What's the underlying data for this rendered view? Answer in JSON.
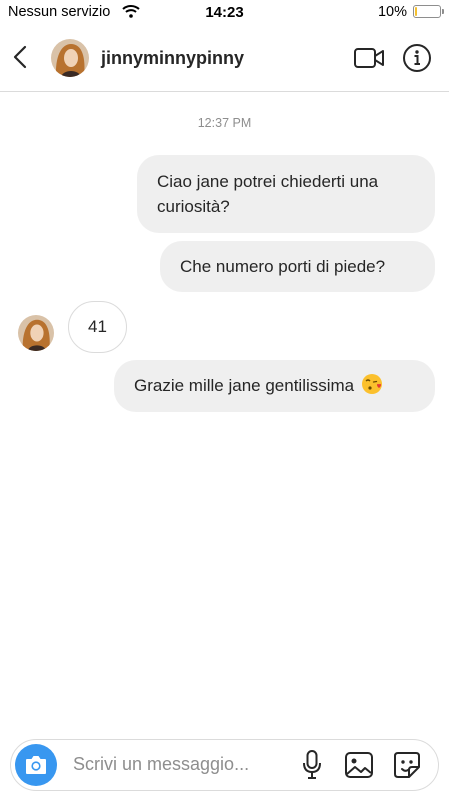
{
  "status_bar": {
    "carrier": "Nessun servizio",
    "time": "14:23",
    "battery_percent": "10%",
    "battery_level": 0.1
  },
  "header": {
    "username": "jinnyminnypinny"
  },
  "conversation": {
    "timestamp": "12:37 PM",
    "messages": [
      {
        "direction": "outgoing",
        "text": "Ciao jane potrei chiederti una curiosità?"
      },
      {
        "direction": "outgoing",
        "text": "Che numero porti di piede?"
      },
      {
        "direction": "incoming",
        "text": "41"
      },
      {
        "direction": "outgoing",
        "text": "Grazie mille jane gentilissima",
        "emoji": "kissing-heart-emoji"
      }
    ]
  },
  "composer": {
    "placeholder": "Scrivi un messaggio..."
  },
  "colors": {
    "accent": "#3897f0",
    "bubble_outgoing": "#efefef",
    "text": "#262626",
    "muted": "#8e8e8e"
  }
}
